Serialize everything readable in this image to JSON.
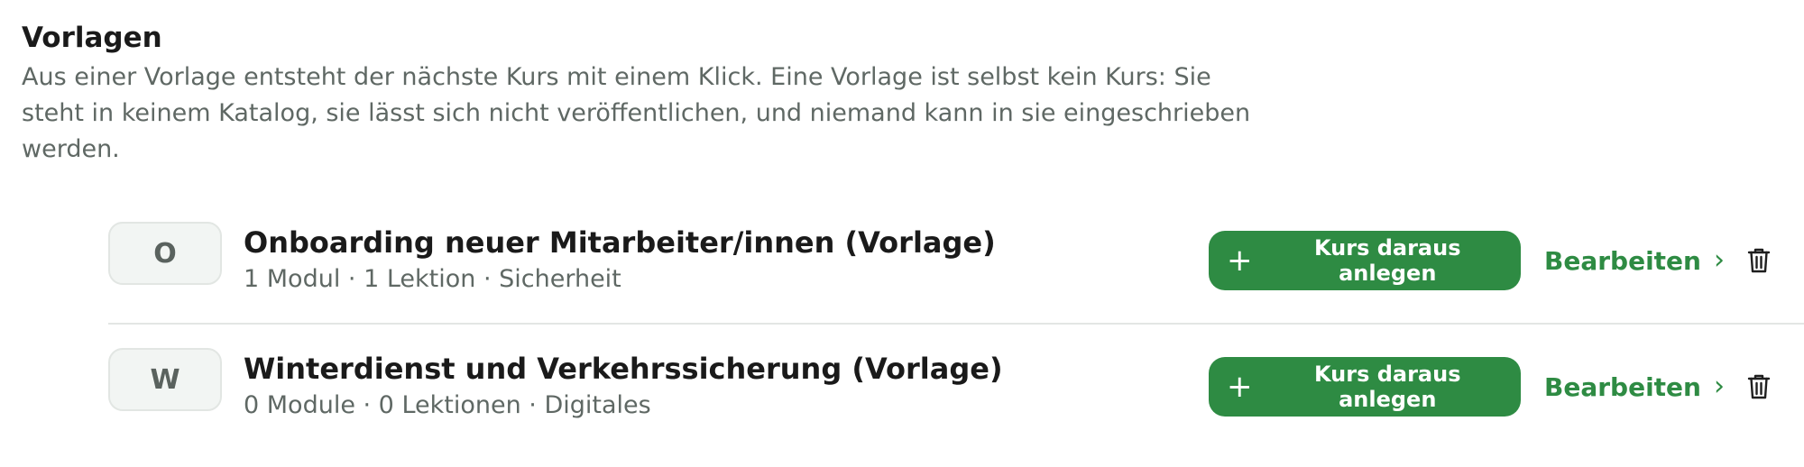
{
  "section": {
    "title": "Vorlagen",
    "description": "Aus einer Vorlage entsteht der nächste Kurs mit einem Klick. Eine Vorlage ist selbst kein Kurs: Sie steht in keinem Katalog, sie lässt sich nicht veröffentlichen, und niemand kann in sie eingeschrieben werden."
  },
  "templates": [
    {
      "avatar_letter": "O",
      "title": "Onboarding neuer Mitarbeiter/innen (Vorlage)",
      "meta": "1 Modul · 1 Lektion · Sicherheit",
      "create_label": "Kurs daraus anlegen",
      "edit_label": "Bearbeiten"
    },
    {
      "avatar_letter": "W",
      "title": "Winterdienst und Verkehrssicherung (Vorlage)",
      "meta": "0 Module · 0 Lektionen · Digitales",
      "create_label": "Kurs daraus anlegen",
      "edit_label": "Bearbeiten"
    }
  ],
  "icons": {
    "plus": "plus-icon",
    "chevron": "chevron-right-icon",
    "delete": "trash-icon"
  },
  "colors": {
    "accent": "#2e8b43",
    "muted_text": "#5f6864",
    "avatar_bg": "#f2f5f3"
  }
}
